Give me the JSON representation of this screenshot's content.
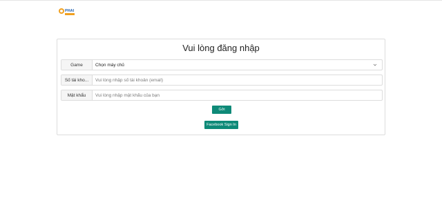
{
  "header": {
    "logo_icon": "game-logo-icon",
    "logo_text_top": "PHAI",
    "colors": {
      "logo_blue": "#1f5fae",
      "logo_orange": "#f0a020"
    }
  },
  "login": {
    "title": "Vui lòng đăng nhập",
    "game_label": "Game",
    "server_select_value": "Chọn máy chủ",
    "account_label": "Số tài kho...",
    "account_placeholder": "Vui lòng nhập số tài khoản (email)",
    "password_label": "Mật khẩu",
    "password_placeholder": "Vui lòng nhập mật khẩu của bạn",
    "submit_label": "Gởi",
    "facebook_label": "Facebook Sign In",
    "colors": {
      "button_bg": "#0e8a78",
      "border": "#dcdcdc"
    }
  }
}
